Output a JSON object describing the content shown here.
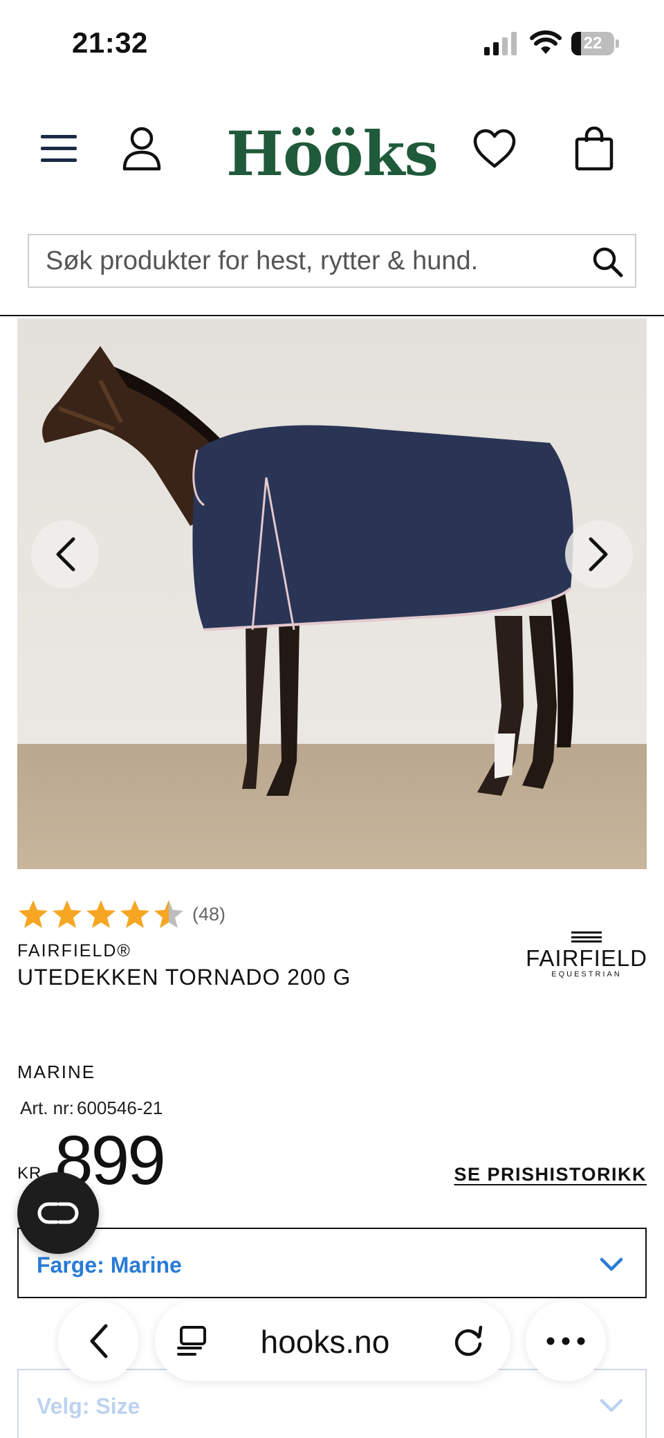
{
  "status_bar": {
    "time": "21:32",
    "battery": "22",
    "battery_level": 0.22
  },
  "header": {
    "logo": "Hööks"
  },
  "search": {
    "placeholder": "Søk produkter for hest, rytter & hund."
  },
  "product": {
    "rating": 4.5,
    "review_count": "(48)",
    "brand": "FAIRFIELD®",
    "title": "UTEDEKKEN TORNADO 200 G",
    "brand_logo": {
      "word": "FAIRFIELD",
      "sub": "EQUESTRIAN"
    },
    "color_name": "MARINE",
    "art_nr_label": "Art. nr:",
    "art_nr": "600546-21",
    "currency": "KR",
    "price": "899",
    "price_history_link": "SE PRISHISTORIKK"
  },
  "selectors": {
    "color": "Farge: Marine",
    "size": "Velg: Size"
  },
  "browser": {
    "url": "hooks.no"
  },
  "colors": {
    "logo_green": "#1f5a3a",
    "select_blue": "#2a7bd6",
    "star_orange": "#f6a623",
    "blanket_navy": "#2a3555"
  }
}
